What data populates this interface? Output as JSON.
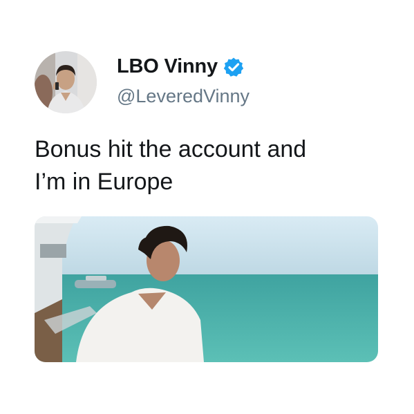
{
  "tweet": {
    "display_name": "LBO Vinny",
    "handle": "@LeveredVinny",
    "verified": true,
    "text_lines": [
      "Bonus hit the account and",
      "I’m in Europe"
    ]
  },
  "icons": {
    "verified": "verified-badge-icon"
  },
  "colors": {
    "name": "#14171a",
    "handle": "#657786",
    "verified": "#1da1f2",
    "sea": "#4fb4ad",
    "sky": "#cfe3ee"
  }
}
